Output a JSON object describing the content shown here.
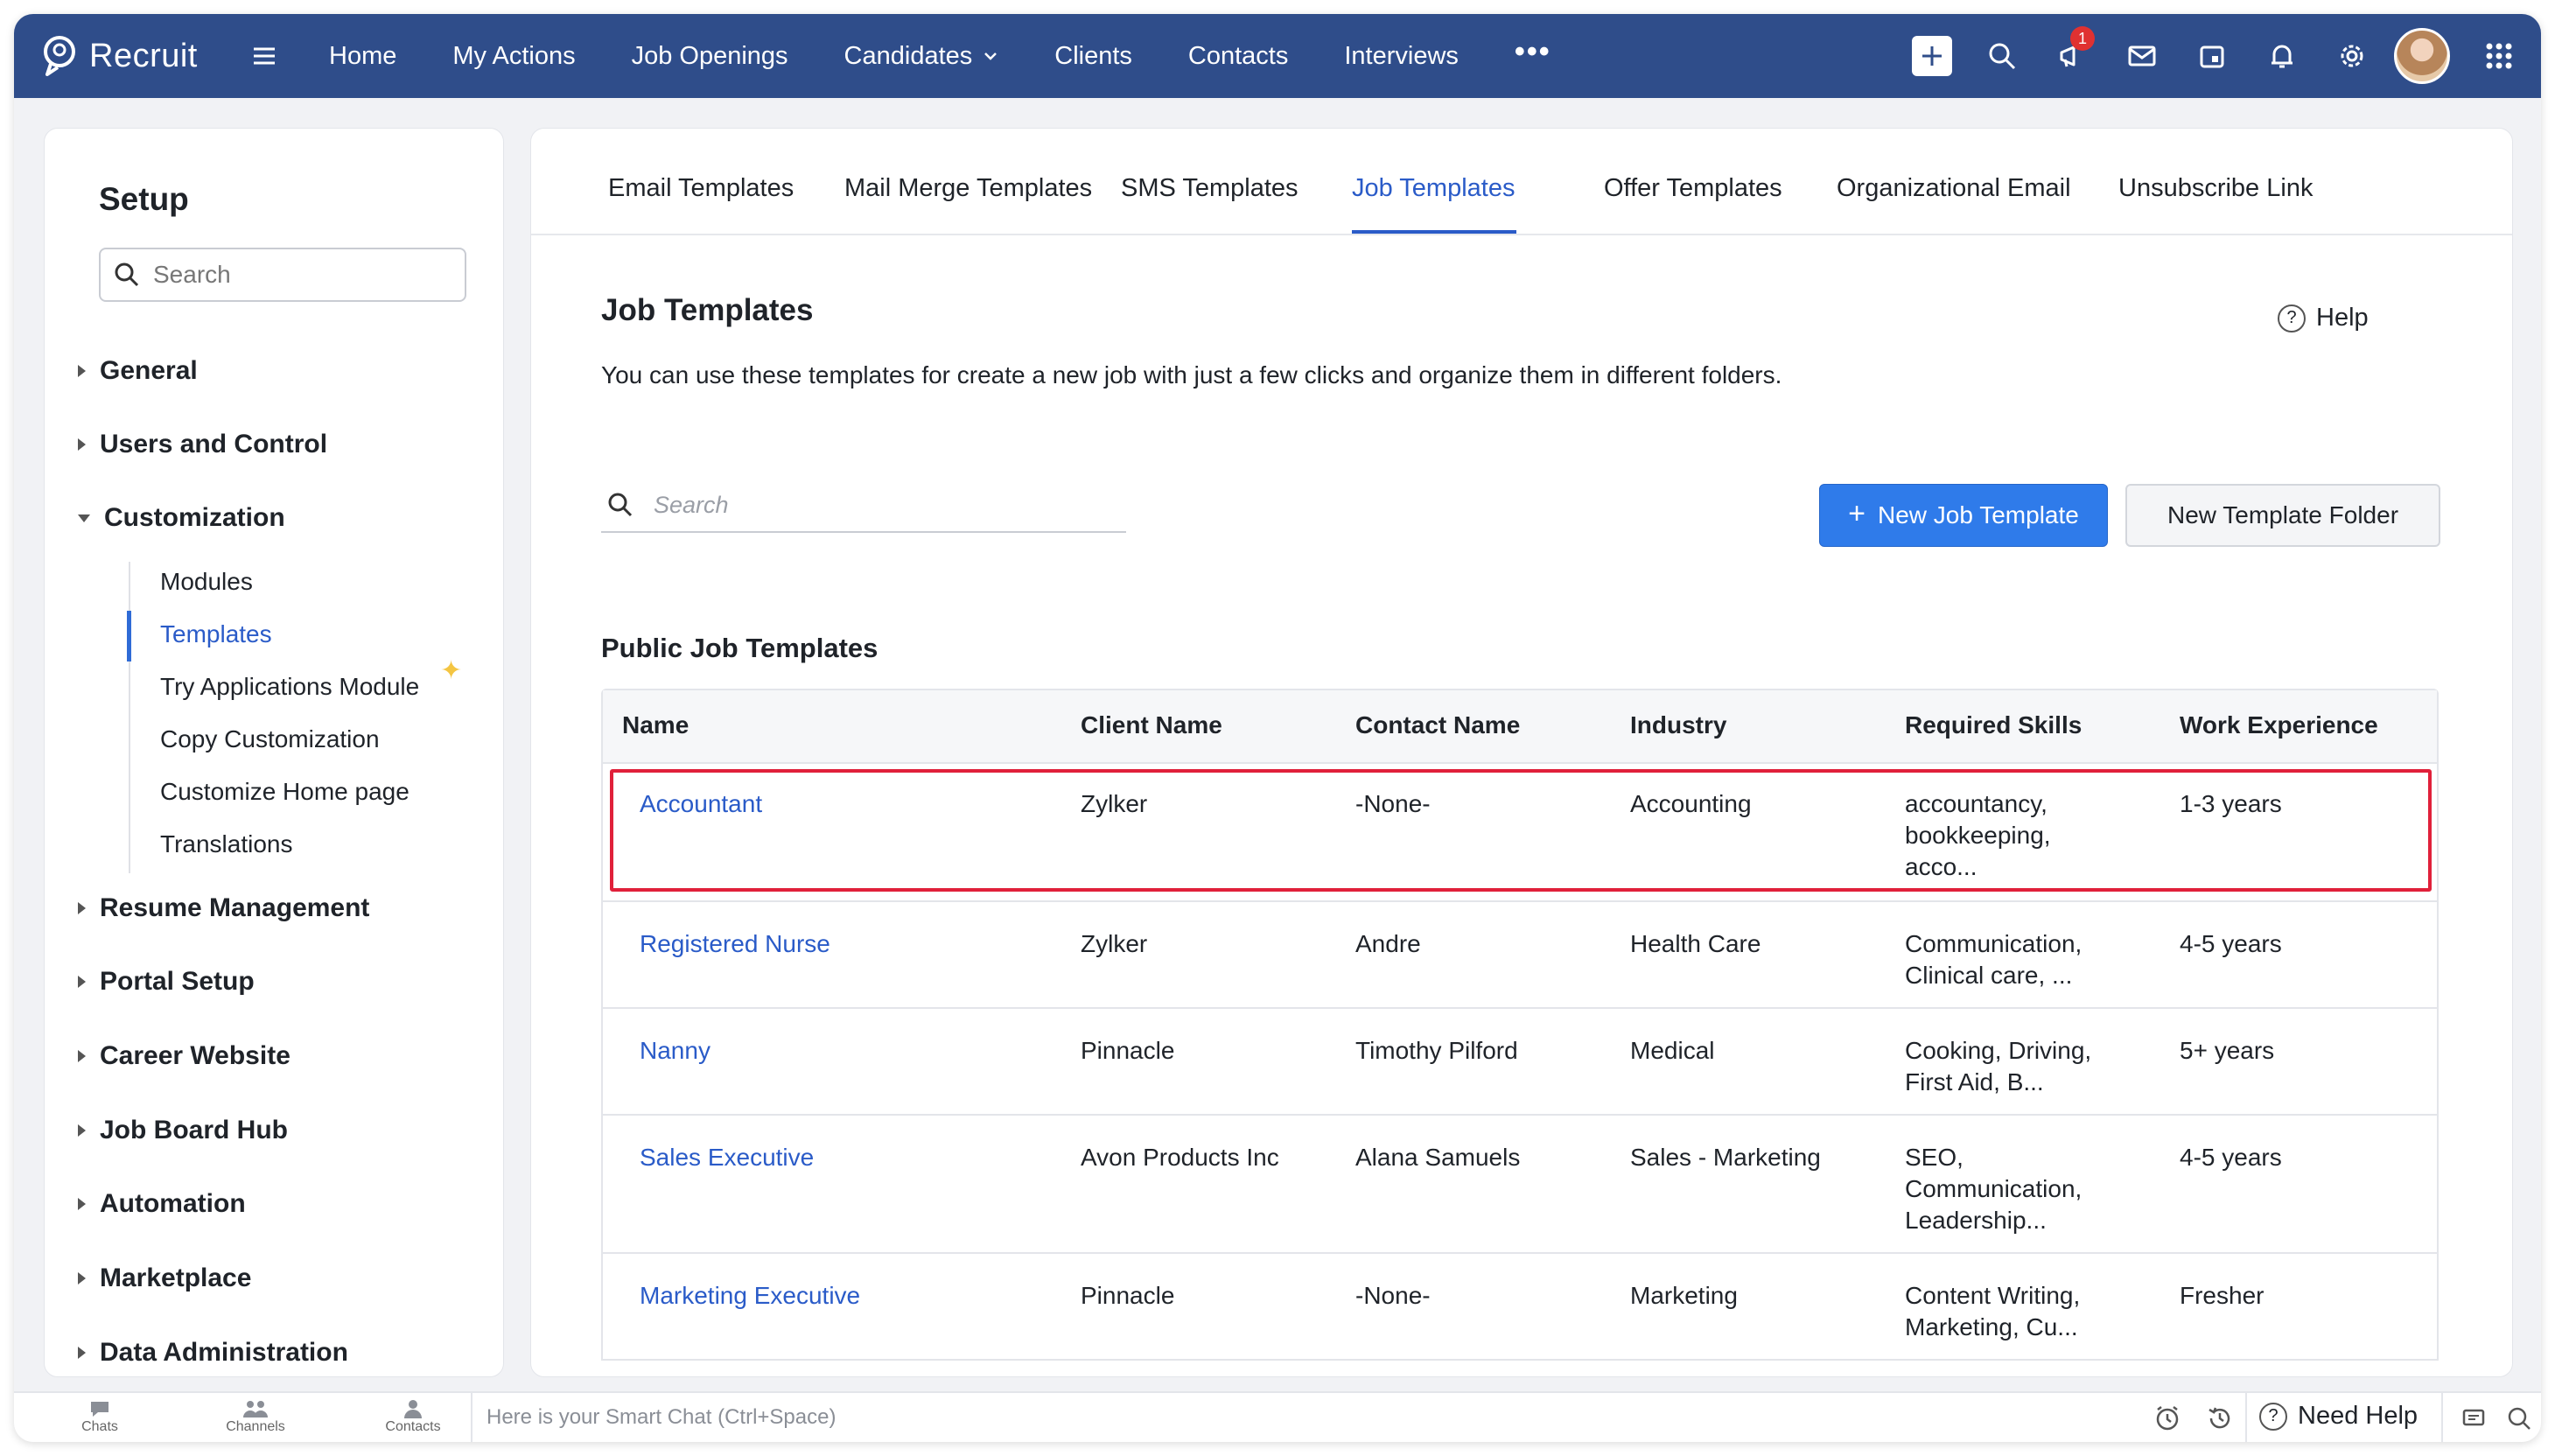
{
  "app": {
    "name": "Recruit"
  },
  "nav": {
    "items": [
      {
        "label": "Home"
      },
      {
        "label": "My Actions"
      },
      {
        "label": "Job Openings"
      },
      {
        "label": "Candidates",
        "has_dropdown": true
      },
      {
        "label": "Clients"
      },
      {
        "label": "Contacts"
      },
      {
        "label": "Interviews"
      }
    ],
    "more_label": "•••",
    "notification_count": "1"
  },
  "setup": {
    "title": "Setup",
    "search_placeholder": "Search",
    "sections": [
      {
        "label": "General"
      },
      {
        "label": "Users and Control"
      },
      {
        "label": "Customization",
        "expanded": true
      },
      {
        "label": "Resume Management"
      },
      {
        "label": "Portal Setup"
      },
      {
        "label": "Career Website"
      },
      {
        "label": "Job Board Hub"
      },
      {
        "label": "Automation"
      },
      {
        "label": "Marketplace"
      },
      {
        "label": "Data Administration"
      }
    ],
    "customization_items": [
      {
        "label": "Modules"
      },
      {
        "label": "Templates",
        "active": true
      },
      {
        "label": "Try Applications Module"
      },
      {
        "label": "Copy Customization"
      },
      {
        "label": "Customize Home page"
      },
      {
        "label": "Translations"
      }
    ]
  },
  "tabs": [
    {
      "label": "Email Templates"
    },
    {
      "label": "Mail Merge Templates"
    },
    {
      "label": "SMS Templates"
    },
    {
      "label": "Job Templates",
      "active": true
    },
    {
      "label": "Offer Templates"
    },
    {
      "label": "Organizational Email"
    },
    {
      "label": "Unsubscribe Link"
    }
  ],
  "page": {
    "title": "Job Templates",
    "help_label": "Help",
    "description": "You can use these templates for create a new job with just a few clicks and organize them in different folders.",
    "search_placeholder": "Search",
    "new_template_label": "New Job Template",
    "new_folder_label": "New Template Folder",
    "section_title": "Public Job Templates"
  },
  "table": {
    "columns": [
      "Name",
      "Client Name",
      "Contact Name",
      "Industry",
      "Required Skills",
      "Work Experience"
    ],
    "rows": [
      {
        "name": "Accountant",
        "client": "Zylker",
        "contact": "-None-",
        "industry": "Accounting",
        "skills": [
          "accountancy,",
          "bookkeeping,",
          "acco..."
        ],
        "experience": "1-3 years",
        "highlighted": true
      },
      {
        "name": "Registered Nurse",
        "client": "Zylker",
        "contact": "Andre",
        "industry": "Health Care",
        "skills": [
          "Communication,",
          "Clinical care, ..."
        ],
        "experience": "4-5 years"
      },
      {
        "name": "Nanny",
        "client": "Pinnacle",
        "contact": "Timothy Pilford",
        "industry": "Medical",
        "skills": [
          "Cooking, Driving,",
          "First Aid, B..."
        ],
        "experience": "5+ years"
      },
      {
        "name": "Sales Executive",
        "client": "Avon Products Inc",
        "contact": "Alana Samuels",
        "industry": "Sales - Marketing",
        "skills": [
          "SEO,",
          "Communication,",
          "Leadership..."
        ],
        "experience": "4-5 years"
      },
      {
        "name": "Marketing Executive",
        "client": "Pinnacle",
        "contact": "-None-",
        "industry": "Marketing",
        "skills": [
          "Content Writing,",
          "Marketing, Cu..."
        ],
        "experience": "Fresher"
      }
    ]
  },
  "bottombar": {
    "chats_label": "Chats",
    "channels_label": "Channels",
    "contacts_label": "Contacts",
    "smartchat_placeholder": "Here is your Smart Chat (Ctrl+Space)",
    "need_help_label": "Need Help"
  },
  "colors": {
    "nav_bg": "#2f4d8a",
    "accent": "#2a5bc8",
    "primary_button": "#2f7bea",
    "highlight_border": "#e0203a"
  }
}
